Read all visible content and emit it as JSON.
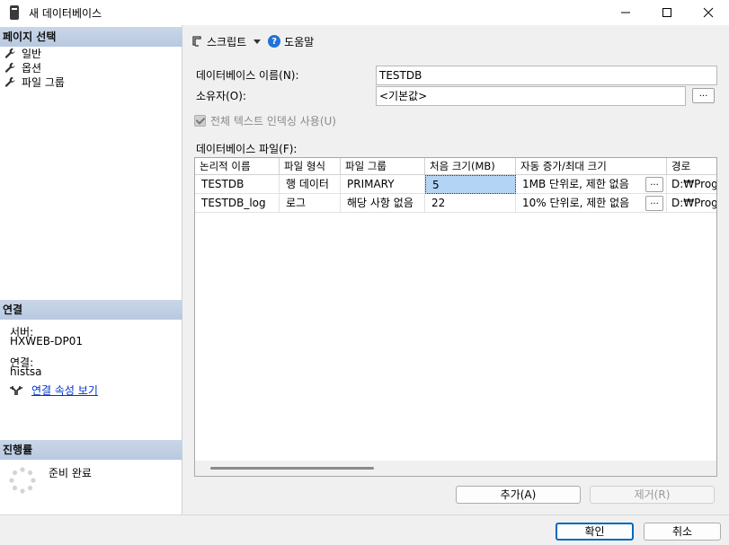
{
  "window": {
    "title": "새 데이터베이스",
    "icon": "database-window-icon"
  },
  "left": {
    "pages_header": "페이지 선택",
    "pages": [
      {
        "label": "일반",
        "icon": "wrench-icon"
      },
      {
        "label": "옵션",
        "icon": "wrench-icon"
      },
      {
        "label": "파일 그룹",
        "icon": "wrench-icon"
      }
    ],
    "connection_header": "연결",
    "server_label": "서버:",
    "server_value": "HXWEB-DP01",
    "connection_label": "연결:",
    "connection_value": "histsa",
    "view_properties_link": "연결 속성 보기",
    "progress_header": "진행률",
    "progress_status": "준비 완료"
  },
  "toolbar": {
    "script_label": "스크립트",
    "help_label": "도움말"
  },
  "form": {
    "db_name_label": "데이터베이스 이름(N):",
    "db_name_value": "TESTDB",
    "owner_label": "소유자(O):",
    "owner_value": "<기본값>",
    "browse_label": "...",
    "fulltext_label": "전체 텍스트 인덱싱 사용(U)",
    "db_files_label": "데이터베이스 파일(F):"
  },
  "grid": {
    "columns": [
      "논리적 이름",
      "파일 형식",
      "파일 그룹",
      "처음 크기(MB)",
      "자동 증가/최대 크기",
      "경로"
    ],
    "rows": [
      {
        "name": "TESTDB",
        "type": "행 데이터",
        "group": "PRIMARY",
        "size": "5",
        "growth": "1MB 단위로, 제한 없음",
        "path": "D:₩Prog"
      },
      {
        "name": "TESTDB_log",
        "type": "로그",
        "group": "해당 사항 없음",
        "size": "22",
        "growth": "10% 단위로, 제한 없음",
        "path": "D:₩Prog"
      }
    ],
    "ellipsis": "..."
  },
  "buttons": {
    "add": "추가(A)",
    "remove": "제거(R)",
    "ok": "확인",
    "cancel": "취소"
  },
  "colors": {
    "accent": "#0067c0",
    "section_header": "#c9d6e8",
    "selected_cell": "#b3d4f5",
    "link": "#0033cc"
  }
}
